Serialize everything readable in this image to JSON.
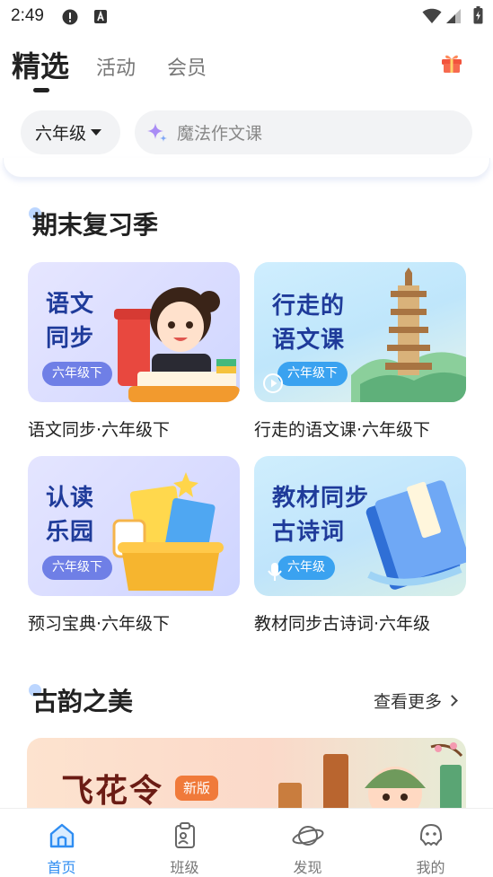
{
  "status_bar": {
    "time": "2:49"
  },
  "top_tabs": [
    {
      "label": "精选",
      "active": true
    },
    {
      "label": "活动",
      "active": false
    },
    {
      "label": "会员",
      "active": false
    }
  ],
  "filter": {
    "grade": "六年级",
    "search_placeholder": "魔法作文课"
  },
  "section1": {
    "title": "期末复习季",
    "courses": [
      {
        "art_title": "语文\n同步",
        "badge": "六年级下",
        "caption": "语文同步·六年级下"
      },
      {
        "art_title": "行走的\n语文课",
        "badge": "六年级下",
        "caption": "行走的语文课·六年级下"
      },
      {
        "art_title": "认读\n乐园",
        "badge": "六年级下",
        "caption": "预习宝典·六年级下"
      },
      {
        "art_title": "教材同步\n古诗词",
        "badge": "六年级",
        "caption": "教材同步古诗词·六年级"
      }
    ]
  },
  "section2": {
    "title": "古韵之美",
    "see_more": "查看更多",
    "banner": {
      "title": "飞花令",
      "badge": "新版"
    }
  },
  "bottom_nav": [
    {
      "label": "首页",
      "active": true
    },
    {
      "label": "班级",
      "active": false
    },
    {
      "label": "发现",
      "active": false
    },
    {
      "label": "我的",
      "active": false
    }
  ],
  "colors": {
    "accent": "#2f8df2",
    "gift": "#f2543d",
    "pill": "#6f7fe6"
  }
}
